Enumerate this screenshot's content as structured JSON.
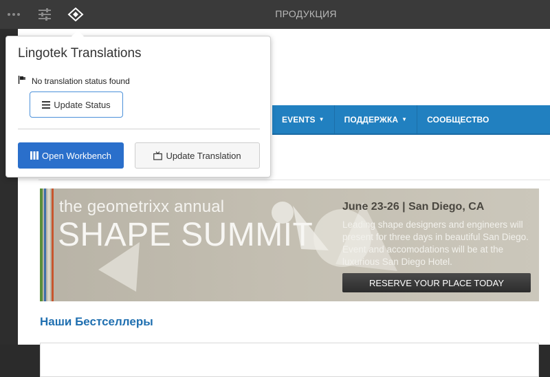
{
  "topbar": {
    "title": "ПРОДУКЦИЯ",
    "icons": [
      "more-icon",
      "settings-sliders-icon",
      "lingotek-logo-icon"
    ]
  },
  "nav": {
    "items": [
      {
        "label": "EVENTS",
        "has_caret": true
      },
      {
        "label": "ПОДДЕРЖКА",
        "has_caret": true
      },
      {
        "label": "СООБЩЕСТВО",
        "has_caret": false
      }
    ],
    "caret": "▼",
    "color": "#2180c0"
  },
  "banner": {
    "small_title": "the geometrixx annual",
    "big_title": "SHAPE SUMMIT",
    "date_line": "June 23-26 | San Diego, CA",
    "description": "Leading shape designers and engineers will present for three days in beautiful San Diego. Event and accomodations will be at the luxurious San Diego Hotel.",
    "reserve_label": "RESERVE YOUR PLACE TODAY",
    "stripe_colors": [
      "#5a8f3a",
      "#3f6fa8",
      "#d9d4c6",
      "#c8562e"
    ]
  },
  "section": {
    "title": "Наши Бестселлеры"
  },
  "popover": {
    "title": "Lingotek Translations",
    "status_text": "No translation status found",
    "update_status_label": "Update Status",
    "open_workbench_label": "Open Workbench",
    "update_translation_label": "Update Translation",
    "accent": "#2a6fcb"
  }
}
